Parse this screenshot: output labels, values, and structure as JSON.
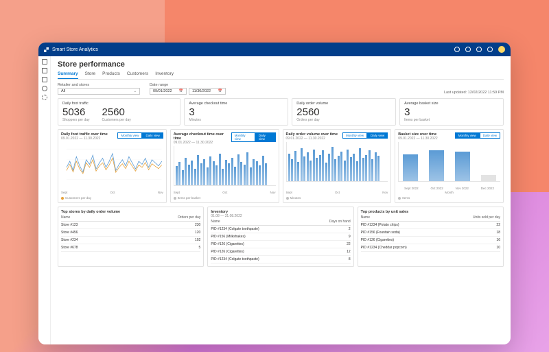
{
  "app_title": "Smart Store Analytics",
  "page_title": "Store performance",
  "tabs": [
    "Summary",
    "Store",
    "Products",
    "Customers",
    "Inventory"
  ],
  "active_tab": 0,
  "filters": {
    "retailer_label": "Retailer and stores",
    "retailer_value": "All",
    "date_label": "Date range",
    "date_from": "09/01/2022",
    "date_to": "11/30/2022"
  },
  "last_updated": "Last updated: 12/02/2022 11:59  PM",
  "kpis": [
    {
      "title": "Daily foot traffic",
      "value": "5036",
      "sub": "Shoppers per day"
    },
    {
      "title": "",
      "value": "2560",
      "sub": "Customers per day"
    },
    {
      "title": "Average checkout time",
      "value": "3",
      "sub": "Minutes"
    },
    {
      "title": "Daily order volume",
      "value": "2560",
      "sub": "Orders per day"
    },
    {
      "title": "Average basket size",
      "value": "3",
      "sub": "Items per basket"
    }
  ],
  "charts": [
    {
      "title": "Daily foot traffic over time",
      "sub": "09.01.2022 — 11.30.2022",
      "monthly": "Monthly view",
      "daily": "Daily view",
      "active": "daily",
      "x_labels": [
        "Sept",
        "Oct",
        "Nov"
      ],
      "legend": "Customers per day",
      "legend_color": "#e6a23c"
    },
    {
      "title": "Average checkout time over time",
      "sub": "09.01.2022 — 11.30.2022",
      "monthly": "Monthly view",
      "daily": "Daily view",
      "active": "daily",
      "x_labels": [
        "Sept",
        "Oct",
        "Nov"
      ],
      "legend": "Items per basket",
      "legend_color": "#c0c0c0"
    },
    {
      "title": "Daily order volume over time",
      "sub": "09.01.2022 — 11.30.2022",
      "monthly": "Monthly view",
      "daily": "Daily view",
      "active": "daily",
      "x_labels": [
        "Sept",
        "Oct",
        "Nov"
      ],
      "legend": "Minutes",
      "legend_color": "#c0c0c0"
    },
    {
      "title": "Basket size over time",
      "sub": "09.01.2022 — 11.30.2022",
      "monthly": "Monthly view",
      "daily": "Daily view",
      "active": "monthly",
      "x_labels": [
        "Sept 2022",
        "Oct 2022",
        "Nov 2022",
        "Dec 2022"
      ],
      "x_axis_label": "Month",
      "legend": "Items",
      "legend_color": "#c0c0c0"
    }
  ],
  "chart_data": [
    {
      "type": "line",
      "title": "Daily foot traffic over time",
      "series": [
        {
          "name": "Shoppers per day",
          "color": "#5b9bd5",
          "values": [
            40,
            60,
            30,
            75,
            45,
            25,
            65,
            50,
            80,
            35,
            55,
            70,
            40,
            60,
            85,
            30,
            50,
            65,
            45,
            75,
            55,
            35,
            60,
            50,
            70,
            40,
            65,
            55,
            45,
            60
          ]
        },
        {
          "name": "Customers per day",
          "color": "#e6a23c",
          "values": [
            30,
            50,
            25,
            60,
            35,
            20,
            55,
            40,
            65,
            28,
            45,
            55,
            32,
            48,
            70,
            24,
            40,
            52,
            36,
            60,
            44,
            28,
            48,
            40,
            56,
            32,
            52,
            44,
            36,
            48
          ]
        }
      ],
      "ylim": [
        0,
        100
      ],
      "x_categories": [
        "Sept",
        "Oct",
        "Nov"
      ]
    },
    {
      "type": "bar",
      "title": "Average checkout time over time",
      "values": [
        35,
        42,
        28,
        50,
        38,
        45,
        30,
        55,
        40,
        48,
        33,
        52,
        44,
        36,
        58,
        30,
        46,
        40,
        50,
        34,
        56,
        42,
        38,
        60,
        32,
        48,
        44,
        36,
        54,
        40
      ],
      "ylim": [
        0,
        70
      ],
      "x_categories": [
        "Sept",
        "Oct",
        "Nov"
      ]
    },
    {
      "type": "bar",
      "title": "Daily order volume over time",
      "values": [
        50,
        40,
        55,
        35,
        60,
        45,
        52,
        38,
        58,
        42,
        48,
        56,
        34,
        50,
        62,
        40,
        46,
        54,
        38,
        58,
        44,
        50,
        36,
        60,
        42,
        48,
        56,
        40,
        52,
        46
      ],
      "ylim": [
        0,
        70
      ],
      "x_categories": [
        "Sept",
        "Oct",
        "Nov"
      ]
    },
    {
      "type": "bar",
      "title": "Basket size over time",
      "categories": [
        "Sept 2022",
        "Oct 2022",
        "Nov 2022",
        "Dec 2022"
      ],
      "values": [
        42,
        48,
        46,
        10
      ],
      "ylim": [
        0,
        60
      ]
    }
  ],
  "tables": [
    {
      "title": "Top stores by daily order volume",
      "sub": "",
      "cols": [
        "Name",
        "Orders per day"
      ],
      "rows": [
        [
          "Store #123",
          "230"
        ],
        [
          "Store #456",
          "120"
        ],
        [
          "Store #234",
          "102"
        ],
        [
          "Store #678",
          "5"
        ]
      ]
    },
    {
      "title": "Inventory",
      "sub": "01.08 — 31.08.2022",
      "cols": [
        "Name",
        "Days on hand"
      ],
      "rows": [
        [
          "PID #1234 (Colgate toothpaste)",
          "2"
        ],
        [
          "PID #156 (Milkshakes)",
          "9"
        ],
        [
          "PID #126 (Cigarettes)",
          "22"
        ],
        [
          "PID #126 (Cigarettes)",
          "12"
        ],
        [
          "PID #1234 (Colgate toothpaste)",
          "8"
        ]
      ]
    },
    {
      "title": "Top products by unit sales",
      "sub": "",
      "cols": [
        "Name",
        "Units sold per day"
      ],
      "rows": [
        [
          "PID #1234 (Potato chips)",
          "22"
        ],
        [
          "PID #156 (Fountain soda)",
          "18"
        ],
        [
          "PID #126 (Cigarettes)",
          "16"
        ],
        [
          "PID #1234 (Cheddar popcorn)",
          "10"
        ]
      ]
    }
  ],
  "rail_items": [
    "menu",
    "home",
    "pin",
    "bulb",
    "gear"
  ]
}
